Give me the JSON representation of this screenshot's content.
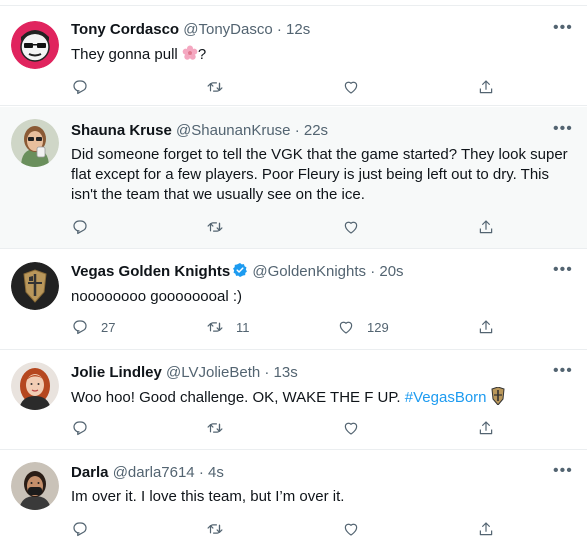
{
  "tweets": [
    {
      "name": "Tony Cordasco",
      "handle": "@TonyDasco",
      "sep": "·",
      "time": "12s",
      "text_before": "They gonna pull ",
      "text_after": "?",
      "emoji": "cherry-blossom-icon",
      "replies": "",
      "retweets": "",
      "likes": ""
    },
    {
      "name": "Shauna Kruse",
      "handle": "@ShaunanKruse",
      "sep": "·",
      "time": "22s",
      "text": "Did someone forget to tell the VGK that the game started? They look super flat except for a few players. Poor Fleury is just being left out to dry. This isn't the team that we usually see on the ice.",
      "replies": "",
      "retweets": "",
      "likes": ""
    },
    {
      "name": "Vegas Golden Knights",
      "handle": "@GoldenKnights",
      "sep": "·",
      "time": "20s",
      "verified": true,
      "text": "noooooooo goooooooal :)",
      "replies": "27",
      "retweets": "11",
      "likes": "129"
    },
    {
      "name": "Jolie Lindley",
      "handle": "@LVJolieBeth",
      "sep": "·",
      "time": "13s",
      "text_before": "Woo hoo! Good challenge. OK, WAKE THE F UP. ",
      "hashtag": "#VegasBorn",
      "emoji": "golden-knights-helmet-icon",
      "replies": "",
      "retweets": "",
      "likes": ""
    },
    {
      "name": "Darla",
      "handle": "@darla7614",
      "sep": "·",
      "time": "4s",
      "text": "Im over it. I love this team, but I’m over it.",
      "replies": "",
      "retweets": "",
      "likes": ""
    }
  ],
  "colors": {
    "accent": "#1d9bf0",
    "muted": "#536471",
    "highlight_bg": "#f7f9f9",
    "divider": "#ebeef0"
  }
}
